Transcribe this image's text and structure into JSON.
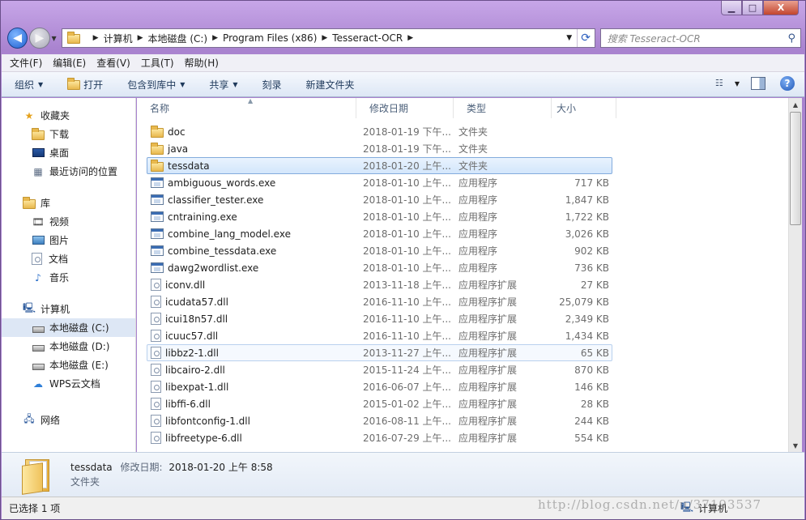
{
  "window": {
    "caption_buttons": {
      "minimize": "▁",
      "maximize": "□",
      "close": "X"
    }
  },
  "address": {
    "crumbs": [
      "计算机",
      "本地磁盘 (C:)",
      "Program Files (x86)",
      "Tesseract-OCR"
    ],
    "search_placeholder": "搜索 Tesseract-OCR"
  },
  "menu": [
    "文件(F)",
    "编辑(E)",
    "查看(V)",
    "工具(T)",
    "帮助(H)"
  ],
  "toolbar": {
    "organize": "组织",
    "open": "打开",
    "include_library": "包含到库中",
    "share": "共享",
    "burn": "刻录",
    "new_folder": "新建文件夹"
  },
  "sidebar": {
    "favorites": {
      "label": "收藏夹",
      "items": [
        "下载",
        "桌面",
        "最近访问的位置"
      ]
    },
    "libraries": {
      "label": "库",
      "items": [
        "视频",
        "图片",
        "文档",
        "音乐"
      ]
    },
    "computer": {
      "label": "计算机",
      "items": [
        "本地磁盘 (C:)",
        "本地磁盘 (D:)",
        "本地磁盘 (E:)",
        "WPS云文档"
      ]
    },
    "network": {
      "label": "网络"
    }
  },
  "columns": {
    "name": "名称",
    "date": "修改日期",
    "type": "类型",
    "size": "大小"
  },
  "files": [
    {
      "name": "doc",
      "date": "2018-01-19 下午...",
      "type": "文件夹",
      "size": "",
      "kind": "folder"
    },
    {
      "name": "java",
      "date": "2018-01-19 下午...",
      "type": "文件夹",
      "size": "",
      "kind": "folder"
    },
    {
      "name": "tessdata",
      "date": "2018-01-20 上午...",
      "type": "文件夹",
      "size": "",
      "kind": "folder"
    },
    {
      "name": "ambiguous_words.exe",
      "date": "2018-01-10 上午...",
      "type": "应用程序",
      "size": "717 KB",
      "kind": "exe"
    },
    {
      "name": "classifier_tester.exe",
      "date": "2018-01-10 上午...",
      "type": "应用程序",
      "size": "1,847 KB",
      "kind": "exe"
    },
    {
      "name": "cntraining.exe",
      "date": "2018-01-10 上午...",
      "type": "应用程序",
      "size": "1,722 KB",
      "kind": "exe"
    },
    {
      "name": "combine_lang_model.exe",
      "date": "2018-01-10 上午...",
      "type": "应用程序",
      "size": "3,026 KB",
      "kind": "exe"
    },
    {
      "name": "combine_tessdata.exe",
      "date": "2018-01-10 上午...",
      "type": "应用程序",
      "size": "902 KB",
      "kind": "exe"
    },
    {
      "name": "dawg2wordlist.exe",
      "date": "2018-01-10 上午...",
      "type": "应用程序",
      "size": "736 KB",
      "kind": "exe"
    },
    {
      "name": "iconv.dll",
      "date": "2013-11-18 上午...",
      "type": "应用程序扩展",
      "size": "27 KB",
      "kind": "dll"
    },
    {
      "name": "icudata57.dll",
      "date": "2016-11-10 上午...",
      "type": "应用程序扩展",
      "size": "25,079 KB",
      "kind": "dll"
    },
    {
      "name": "icui18n57.dll",
      "date": "2016-11-10 上午...",
      "type": "应用程序扩展",
      "size": "2,349 KB",
      "kind": "dll"
    },
    {
      "name": "icuuc57.dll",
      "date": "2016-11-10 上午...",
      "type": "应用程序扩展",
      "size": "1,434 KB",
      "kind": "dll"
    },
    {
      "name": "libbz2-1.dll",
      "date": "2013-11-27 上午...",
      "type": "应用程序扩展",
      "size": "65 KB",
      "kind": "dll"
    },
    {
      "name": "libcairo-2.dll",
      "date": "2015-11-24 上午...",
      "type": "应用程序扩展",
      "size": "870 KB",
      "kind": "dll"
    },
    {
      "name": "libexpat-1.dll",
      "date": "2016-06-07 上午...",
      "type": "应用程序扩展",
      "size": "146 KB",
      "kind": "dll"
    },
    {
      "name": "libffi-6.dll",
      "date": "2015-01-02 上午...",
      "type": "应用程序扩展",
      "size": "28 KB",
      "kind": "dll"
    },
    {
      "name": "libfontconfig-1.dll",
      "date": "2016-08-11 上午...",
      "type": "应用程序扩展",
      "size": "244 KB",
      "kind": "dll"
    },
    {
      "name": "libfreetype-6.dll",
      "date": "2016-07-29 上午...",
      "type": "应用程序扩展",
      "size": "554 KB",
      "kind": "dll"
    }
  ],
  "selected_file_index": 2,
  "hover_file_index": 13,
  "details": {
    "name": "tessdata",
    "date_label": "修改日期:",
    "date_value": "2018-01-20 上午 8:58",
    "type": "文件夹"
  },
  "status": {
    "selection": "已选择 1 项",
    "location": "计算机"
  },
  "watermark": "http://blog.csdn.net/u/37193537"
}
